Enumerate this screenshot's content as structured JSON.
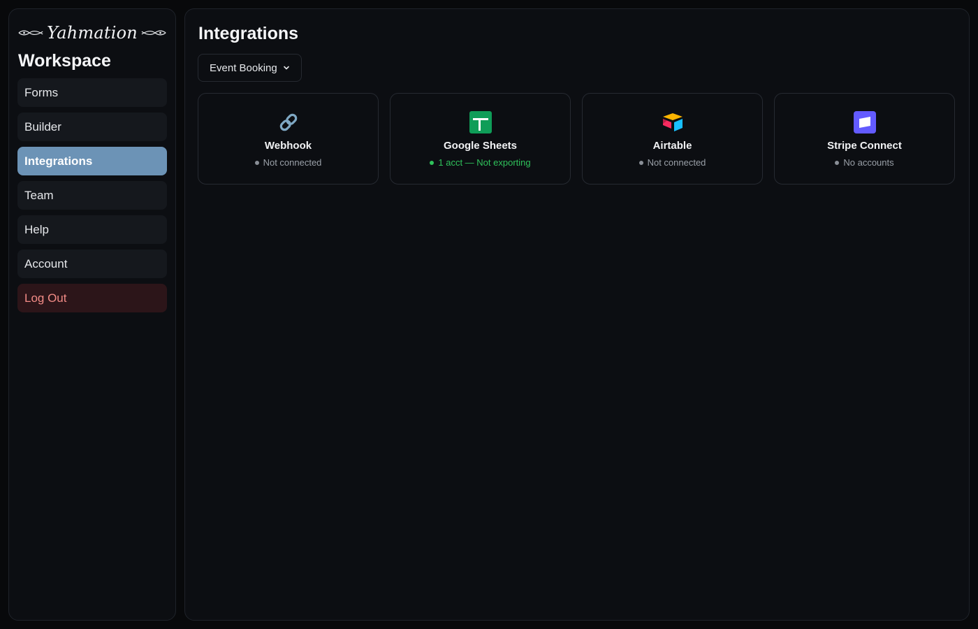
{
  "brand": {
    "logo_text": "Yahmation"
  },
  "sidebar": {
    "title": "Workspace",
    "items": [
      {
        "label": "Forms"
      },
      {
        "label": "Builder"
      },
      {
        "label": "Integrations",
        "active": true
      },
      {
        "label": "Team"
      },
      {
        "label": "Help"
      },
      {
        "label": "Account"
      },
      {
        "label": "Log Out",
        "danger": true
      }
    ]
  },
  "main": {
    "title": "Integrations",
    "form_selector": {
      "selected": "Event Booking",
      "icon": "chevron-down-icon"
    },
    "integrations": [
      {
        "name": "Webhook",
        "status": "Not connected",
        "status_type": "neutral",
        "icon": "link-icon"
      },
      {
        "name": "Google Sheets",
        "status": "1 acct — Not exporting",
        "status_type": "connected",
        "icon": "google-sheets-icon"
      },
      {
        "name": "Airtable",
        "status": "Not connected",
        "status_type": "neutral",
        "icon": "airtable-icon"
      },
      {
        "name": "Stripe Connect",
        "status": "No accounts",
        "status_type": "neutral",
        "icon": "stripe-icon"
      }
    ]
  },
  "colors": {
    "background": "#08090b",
    "panel": "#0c0e12",
    "nav_item": "#15181d",
    "active": "#6c93b6",
    "logout_bg": "#2c1519",
    "logout_text": "#f28b86",
    "connected": "#2fc25b",
    "neutral_dot": "#8a8f97"
  }
}
